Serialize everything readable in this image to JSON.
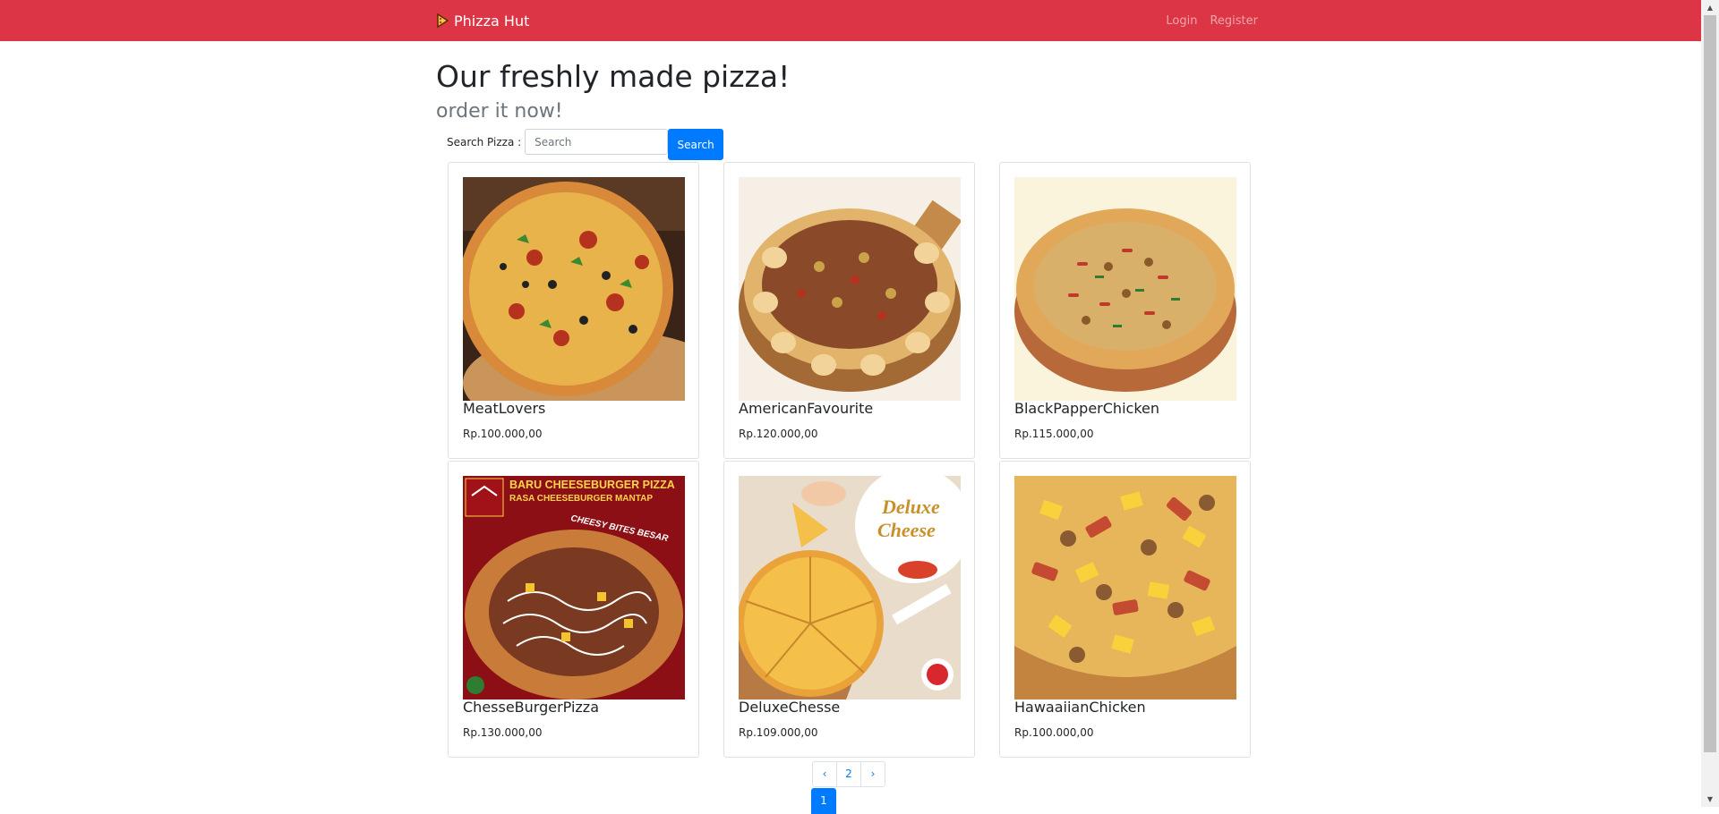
{
  "navbar": {
    "brand": "Phizza Hut",
    "login": "Login",
    "register": "Register",
    "color": "#dc3545"
  },
  "hero": {
    "title": "Our freshly made pizza!",
    "subtitle": "order it now!"
  },
  "search": {
    "label": "Search Pizza :",
    "placeholder": "Search",
    "button": "Search"
  },
  "products": [
    {
      "name": "MeatLovers",
      "price": "Rp.100.000,00"
    },
    {
      "name": "AmericanFavourite",
      "price": "Rp.120.000,00"
    },
    {
      "name": "BlackPapperChicken",
      "price": "Rp.115.000,00"
    },
    {
      "name": "ChesseBurgerPizza",
      "price": "Rp.130.000,00"
    },
    {
      "name": "DeluxeChesse",
      "price": "Rp.109.000,00"
    },
    {
      "name": "HawaaiianChicken",
      "price": "Rp.100.000,00"
    }
  ],
  "pagination": {
    "prev": "‹",
    "pages": [
      "2"
    ],
    "next": "›",
    "active": "1"
  },
  "images": {
    "cheeseburger": {
      "line1": "BARU CHEESEBURGER PIZZA",
      "line2": "RASA CHEESEBURGER MANTAP",
      "line3": "CHEESY BITES BESAR"
    },
    "deluxe": {
      "line1": "Deluxe",
      "line2": "Cheese"
    }
  }
}
